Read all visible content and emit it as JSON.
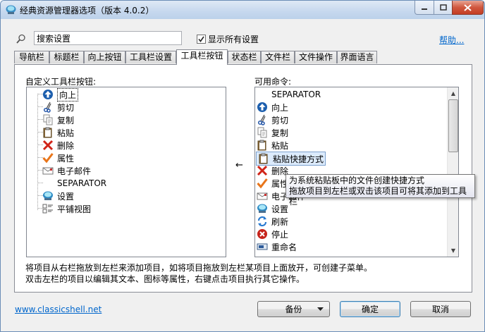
{
  "window": {
    "title": "经典资源管理器选项（版本 4.0.2）"
  },
  "search": {
    "placeholder": "搜索设置",
    "value": "搜索设置"
  },
  "show_all": {
    "label": "显示所有设置",
    "checked": true
  },
  "help_link": "帮助...",
  "tabs": [
    {
      "label": "导航栏"
    },
    {
      "label": "标题栏"
    },
    {
      "label": "向上按钮"
    },
    {
      "label": "工具栏设置"
    },
    {
      "label": "工具栏按钮",
      "active": true
    },
    {
      "label": "状态栏"
    },
    {
      "label": "文件栏"
    },
    {
      "label": "文件操作"
    },
    {
      "label": "界面语言"
    }
  ],
  "left_panel": {
    "label": "自定义工具栏按钮:",
    "items": [
      {
        "label": "向上",
        "icon": "up-arrow-icon",
        "selected": true
      },
      {
        "label": "剪切",
        "icon": "scissors-icon"
      },
      {
        "label": "复制",
        "icon": "copy-icon"
      },
      {
        "label": "粘贴",
        "icon": "paste-icon"
      },
      {
        "label": "删除",
        "icon": "delete-x-icon"
      },
      {
        "label": "属性",
        "icon": "checkmark-icon"
      },
      {
        "label": "电子邮件",
        "icon": "email-icon"
      },
      {
        "label": "SEPARATOR",
        "icon": ""
      },
      {
        "label": "设置",
        "icon": "shell-icon"
      },
      {
        "label": "平铺视图",
        "icon": "tile-view-icon"
      }
    ]
  },
  "arrow_glyph": "←",
  "right_panel": {
    "label": "可用命令:",
    "items": [
      {
        "label": "SEPARATOR",
        "icon": ""
      },
      {
        "label": "向上",
        "icon": "up-arrow-icon"
      },
      {
        "label": "剪切",
        "icon": "scissors-icon"
      },
      {
        "label": "复制",
        "icon": "copy-icon"
      },
      {
        "label": "粘贴",
        "icon": "paste-icon"
      },
      {
        "label": "粘贴快捷方式",
        "icon": "paste-shortcut-icon",
        "selected": true
      },
      {
        "label": "删除",
        "icon": "delete-x-icon"
      },
      {
        "label": "属性",
        "icon": "checkmark-icon"
      },
      {
        "label": "电子邮件",
        "icon": "email-icon"
      },
      {
        "label": "设置",
        "icon": "shell-icon"
      },
      {
        "label": "刷新",
        "icon": "refresh-icon"
      },
      {
        "label": "停止",
        "icon": "stop-icon"
      },
      {
        "label": "重命名",
        "icon": "rename-icon"
      }
    ]
  },
  "tooltip": {
    "line1": "为系统粘贴板中的文件创建快捷方式",
    "line2": "拖放项目到左栏或双击该项目可将其添加到工具栏"
  },
  "description": {
    "line1": "将项目从右栏拖放到左栏来添加项目，如将项目拖放到左栏某项目上面放开，可创建子菜单。",
    "line2": "双击左栏的项目以编辑其文本、图标等属性，右键点击项目执行其它操作。"
  },
  "footer": {
    "link": "www.classicshell.net",
    "backup_label": "备份",
    "ok_label": "确定",
    "cancel_label": "取消"
  },
  "colors": {
    "link": "#0066cc",
    "selection": "#dcebfc",
    "title_gradient_top": "#dfe9f5"
  }
}
